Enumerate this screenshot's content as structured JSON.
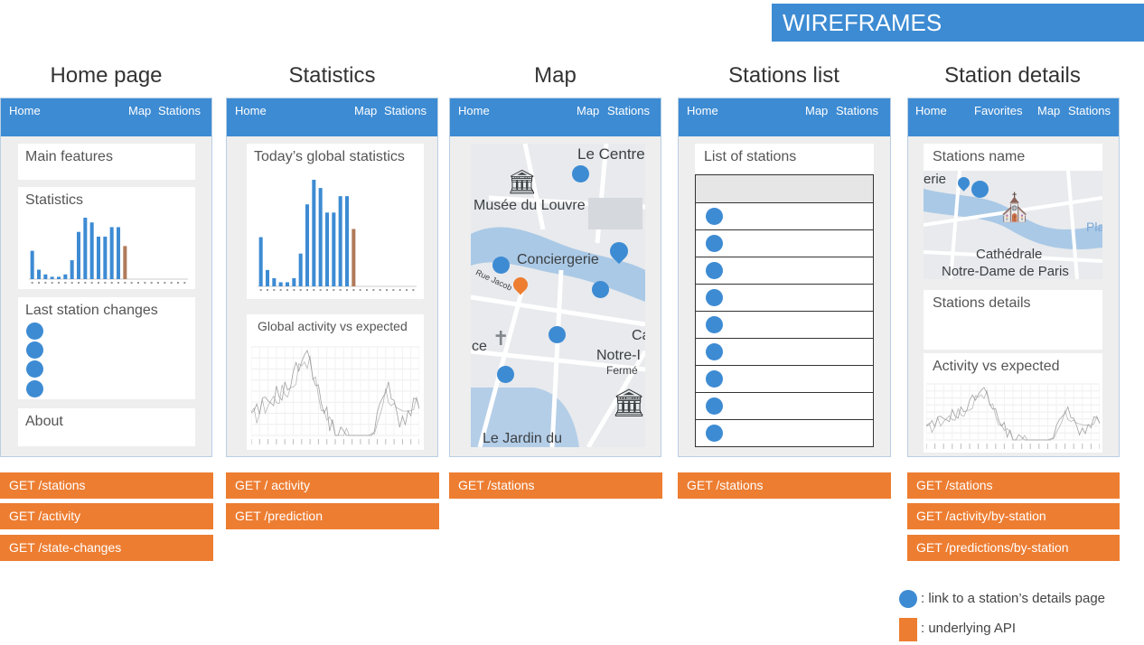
{
  "banner": "WIREFRAMES",
  "columns": {
    "home": {
      "title": "Home page",
      "nav": {
        "home": "Home",
        "map": "Map",
        "stations": "Stations"
      },
      "cards": {
        "main_features": "Main features",
        "statistics": "Statistics",
        "last_changes": "Last station changes",
        "about": "About"
      },
      "apis": [
        "GET /stations",
        "GET /activity",
        "GET /state-changes"
      ]
    },
    "statistics": {
      "title": "Statistics",
      "nav": {
        "home": "Home",
        "map": "Map",
        "stations": "Stations"
      },
      "cards": {
        "global": "Today’s global statistics",
        "activity": "Global activity vs expected"
      },
      "apis": [
        "GET / activity",
        "GET /prediction"
      ]
    },
    "map": {
      "title": "Map",
      "nav": {
        "home": "Home",
        "map": "Map",
        "stations": "Stations"
      },
      "labels": {
        "le_centre": "Le Centre",
        "louvre": "Musée du Louvre",
        "conciergerie": "Conciergerie",
        "rue_jacob": "Rue Jacob",
        "notre": "Notre-I",
        "ferme": "Fermé",
        "jardin": "Le Jardin du",
        "ce": "ce",
        "ca": "Ca"
      },
      "apis": [
        "GET /stations"
      ]
    },
    "stations_list": {
      "title": "Stations list",
      "nav": {
        "home": "Home",
        "map": "Map",
        "stations": "Stations"
      },
      "list_title": "List of stations",
      "apis": [
        "GET /stations"
      ]
    },
    "station_details": {
      "title": "Station details",
      "nav": {
        "home": "Home",
        "favorites": "Favorites",
        "map": "Map",
        "stations": "Stations"
      },
      "cards": {
        "name": "Stations name",
        "details": "Stations details",
        "activity": "Activity vs expected"
      },
      "map_labels": {
        "erie": "erie",
        "cathedrale": "Cathédrale",
        "notre_dame": "Notre-Dame de Paris",
        "pla": "Pla"
      },
      "apis": [
        "GET /stations",
        "GET /activity/by-station",
        "GET /predictions/by-station"
      ]
    }
  },
  "legend": {
    "dot": ": link to a station’s details page",
    "api": ": underlying API"
  },
  "colors": {
    "primary": "#3d8bd3",
    "api": "#ed7d31",
    "bar_highlight": "#b07a5a"
  },
  "chart_data": [
    {
      "type": "bar",
      "values": [
        6,
        2,
        1,
        0.5,
        0.5,
        1,
        4,
        10,
        13,
        12,
        9,
        9,
        11,
        11,
        7,
        0,
        0,
        0,
        0,
        0,
        0,
        0,
        0,
        0
      ],
      "highlight_index": 14
    },
    {
      "type": "bar",
      "values": [
        6,
        2,
        1,
        0.5,
        0.5,
        1,
        4,
        10,
        13,
        12,
        9,
        9,
        11,
        11,
        7,
        0,
        0,
        0,
        0,
        0,
        0,
        0,
        0,
        0
      ],
      "highlight_index": 14
    },
    {
      "type": "line"
    },
    {
      "type": "line"
    }
  ]
}
